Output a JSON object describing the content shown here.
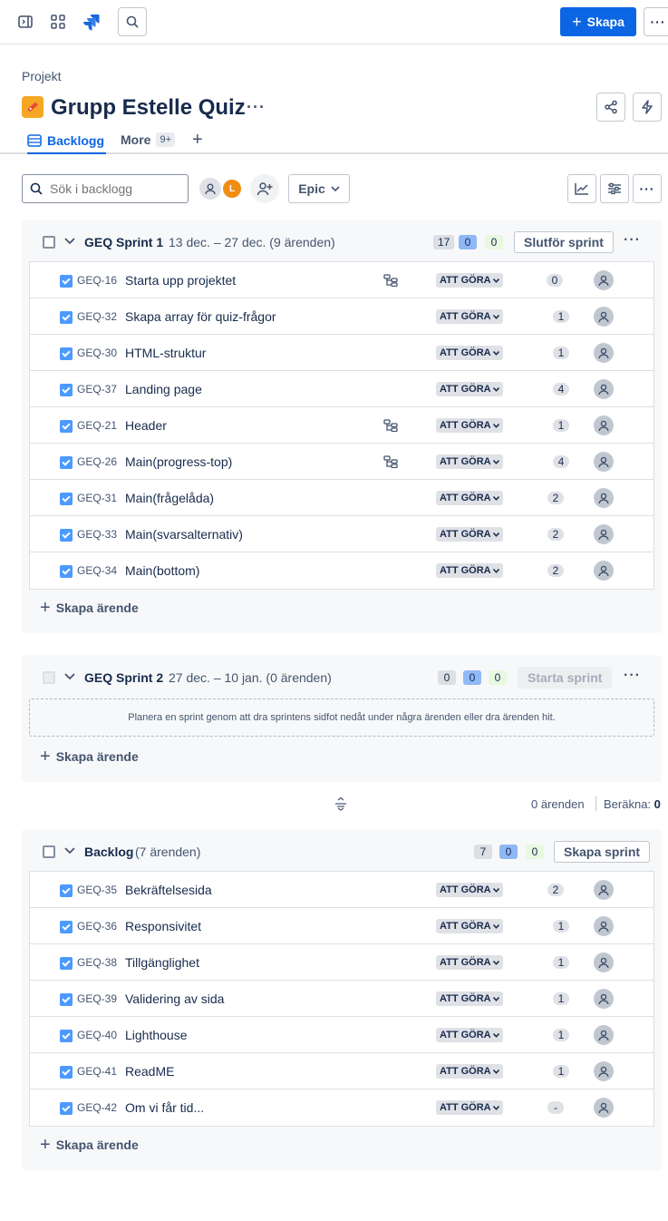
{
  "nav": {
    "create_label": "Skapa"
  },
  "header": {
    "breadcrumb": "Projekt",
    "title": "Grupp Estelle Quiz",
    "tabs": {
      "backlog": "Backlogg",
      "more": "More",
      "more_count": "9+"
    }
  },
  "filters": {
    "search_placeholder": "Sök i backlogg",
    "avatar_initial": "L",
    "epic_label": "Epic"
  },
  "sprint1": {
    "name": "GEQ Sprint 1",
    "dates": "13 dec. – 27 dec. (9 ärenden)",
    "counts": {
      "todo": "17",
      "in_progress": "0",
      "done": "0"
    },
    "action": "Slutför sprint",
    "issues": [
      {
        "key": "GEQ-16",
        "summary": "Starta upp projektet",
        "status": "ATT GÖRA",
        "estimate": "0",
        "has_children": true
      },
      {
        "key": "GEQ-32",
        "summary": "Skapa array för quiz-frågor",
        "status": "ATT GÖRA",
        "estimate": "1",
        "has_children": false
      },
      {
        "key": "GEQ-30",
        "summary": "HTML-struktur",
        "status": "ATT GÖRA",
        "estimate": "1",
        "has_children": false
      },
      {
        "key": "GEQ-37",
        "summary": "Landing page",
        "status": "ATT GÖRA",
        "estimate": "4",
        "has_children": false
      },
      {
        "key": "GEQ-21",
        "summary": "Header",
        "status": "ATT GÖRA",
        "estimate": "1",
        "has_children": true
      },
      {
        "key": "GEQ-26",
        "summary": "Main(progress-top)",
        "status": "ATT GÖRA",
        "estimate": "4",
        "has_children": true
      },
      {
        "key": "GEQ-31",
        "summary": "Main(frågelåda)",
        "status": "ATT GÖRA",
        "estimate": "2",
        "has_children": false
      },
      {
        "key": "GEQ-33",
        "summary": "Main(svarsalternativ)",
        "status": "ATT GÖRA",
        "estimate": "2",
        "has_children": false
      },
      {
        "key": "GEQ-34",
        "summary": "Main(bottom)",
        "status": "ATT GÖRA",
        "estimate": "2",
        "has_children": false
      }
    ],
    "create_issue": "Skapa ärende"
  },
  "sprint2": {
    "name": "GEQ Sprint 2",
    "dates": "27 dec. – 10 jan. (0 ärenden)",
    "counts": {
      "todo": "0",
      "in_progress": "0",
      "done": "0"
    },
    "action": "Starta sprint",
    "empty_text": "Planera en sprint genom att dra sprintens sidfot nedåt under några ärenden eller dra ärenden hit.",
    "create_issue": "Skapa ärende"
  },
  "summary_bar": {
    "issues": "0 ärenden",
    "estimate_label": "Beräkna:",
    "estimate_value": "0"
  },
  "backlog": {
    "name": "Backlog",
    "count": "(7 ärenden)",
    "counts": {
      "todo": "7",
      "in_progress": "0",
      "done": "0"
    },
    "action": "Skapa sprint",
    "issues": [
      {
        "key": "GEQ-35",
        "summary": "Bekräftelsesida",
        "status": "ATT GÖRA",
        "estimate": "2"
      },
      {
        "key": "GEQ-36",
        "summary": "Responsivitet",
        "status": "ATT GÖRA",
        "estimate": "1"
      },
      {
        "key": "GEQ-38",
        "summary": "Tillgänglighet",
        "status": "ATT GÖRA",
        "estimate": "1"
      },
      {
        "key": "GEQ-39",
        "summary": "Validering av sida",
        "status": "ATT GÖRA",
        "estimate": "1"
      },
      {
        "key": "GEQ-40",
        "summary": "Lighthouse",
        "status": "ATT GÖRA",
        "estimate": "1"
      },
      {
        "key": "GEQ-41",
        "summary": "ReadME",
        "status": "ATT GÖRA",
        "estimate": "1"
      },
      {
        "key": "GEQ-42",
        "summary": "Om vi får tid...",
        "status": "ATT GÖRA",
        "estimate": "-"
      }
    ],
    "create_issue": "Skapa ärende"
  },
  "colors": {
    "accent": "#0c66e4",
    "status_pill": "#dfe1e6",
    "project_icon": "#f5a623",
    "avatar_l": "#f18d13"
  }
}
